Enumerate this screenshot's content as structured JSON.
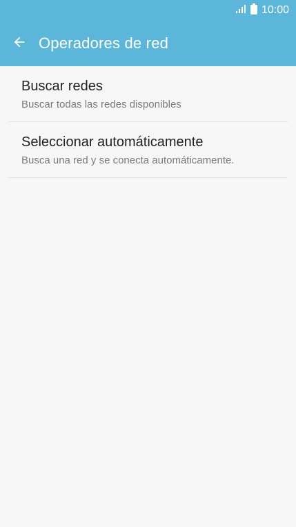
{
  "status": {
    "time": "10:00",
    "signal_icon": "signal-icon",
    "battery_icon": "battery-icon"
  },
  "header": {
    "title": "Operadores de red",
    "back_icon": "back-arrow-icon"
  },
  "items": [
    {
      "title": "Buscar redes",
      "subtitle": "Buscar todas las redes disponibles"
    },
    {
      "title": "Seleccionar automáticamente",
      "subtitle": "Busca una red y se conecta automáticamente."
    }
  ],
  "colors": {
    "accent": "#5bb6da",
    "background": "#f7f7f7",
    "text": "#222222",
    "subtext": "#7a7a7a"
  }
}
